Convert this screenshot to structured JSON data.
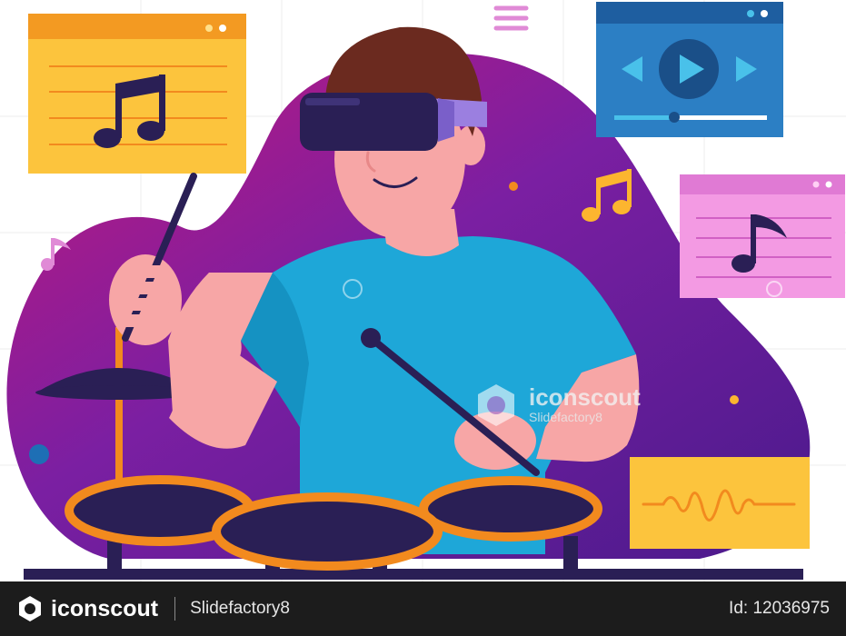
{
  "watermark": {
    "brand": "iconscout",
    "author": "Slidefactory8"
  },
  "footer": {
    "brand": "iconscout",
    "author": "Slidefactory8",
    "id": "Id: 12036975"
  },
  "colors": {
    "blob_purple": "#6a1b9a",
    "blob_magenta": "#c2187b",
    "shirt": "#1ea7d8",
    "skin": "#f7a6a6",
    "hair": "#6b2a1f",
    "vr_headset": "#2a1f55",
    "drum_rim": "#f28a1e",
    "drum_head": "#2a1f55",
    "yellow_window": "#fcb52f",
    "blue_window": "#1e6fb5",
    "pink_window": "#f08bd9",
    "footer_bg": "#1c1c1c"
  }
}
